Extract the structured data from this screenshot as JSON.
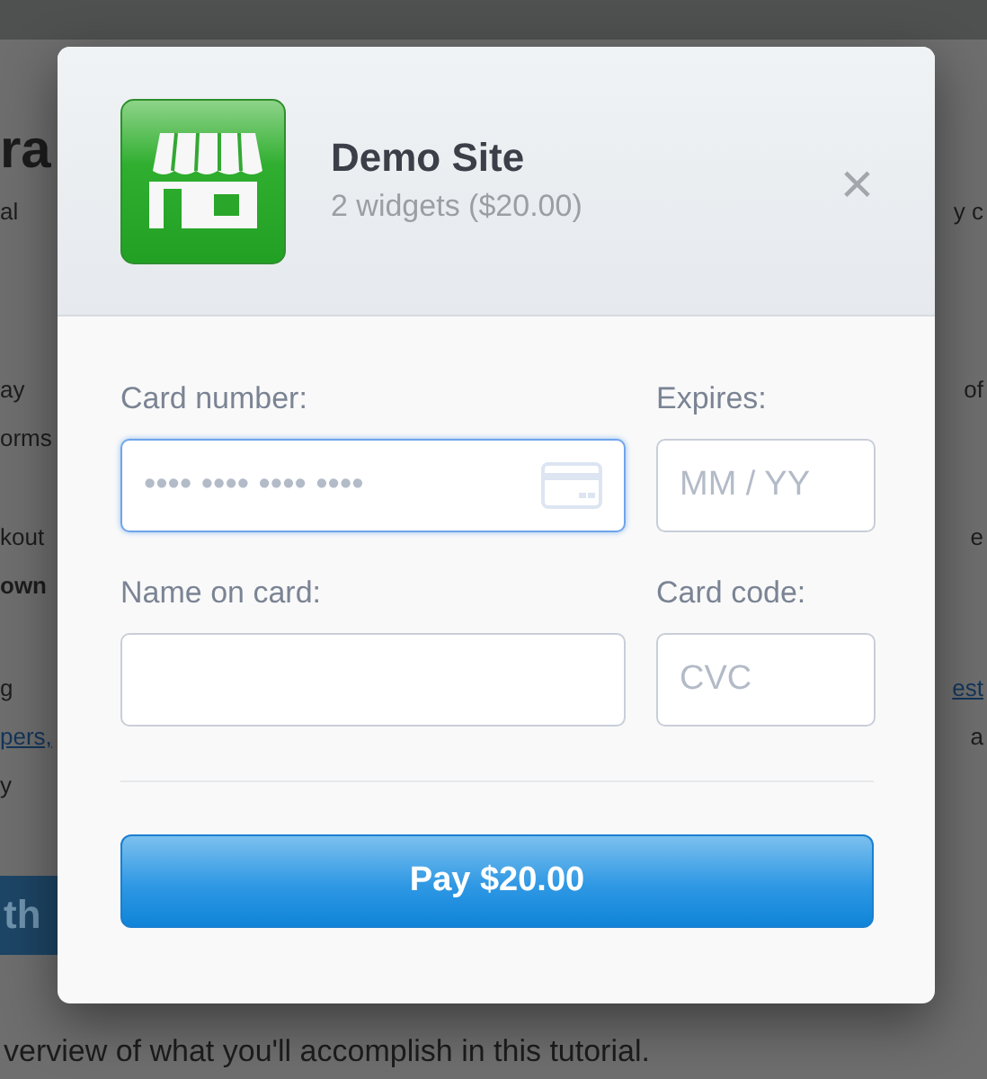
{
  "background_page": {
    "heading": "ra",
    "rows": [
      {
        "left": "al",
        "right": "y c"
      },
      {
        "left": "ay",
        "right": "of"
      },
      {
        "left": "orms"
      },
      {
        "left": "kout",
        "right": "e"
      },
      {
        "left": "own",
        "bold": true
      },
      {
        "left": "g",
        "right": "est",
        "right_link": true
      },
      {
        "left": "pers,",
        "left_link": true,
        "right": "a"
      },
      {
        "left": "y"
      }
    ],
    "button": "th",
    "footer": "verview of what you'll accomplish in this tutorial."
  },
  "dialog": {
    "title": "Demo Site",
    "subtitle": "2 widgets ($20.00)",
    "close": "×",
    "fields": [
      {
        "kind": "card",
        "label": "Card number:",
        "placeholder": "•••• •••• •••• ••••",
        "focused": true
      },
      {
        "kind": "text",
        "label": "Expires:",
        "placeholder": "MM / YY",
        "focused": false
      },
      {
        "kind": "text",
        "label": "Name on card:",
        "focused": false
      },
      {
        "kind": "text",
        "label": "Card code:",
        "placeholder": "CVC",
        "focused": false
      }
    ],
    "pay_button": "Pay $20.00"
  }
}
